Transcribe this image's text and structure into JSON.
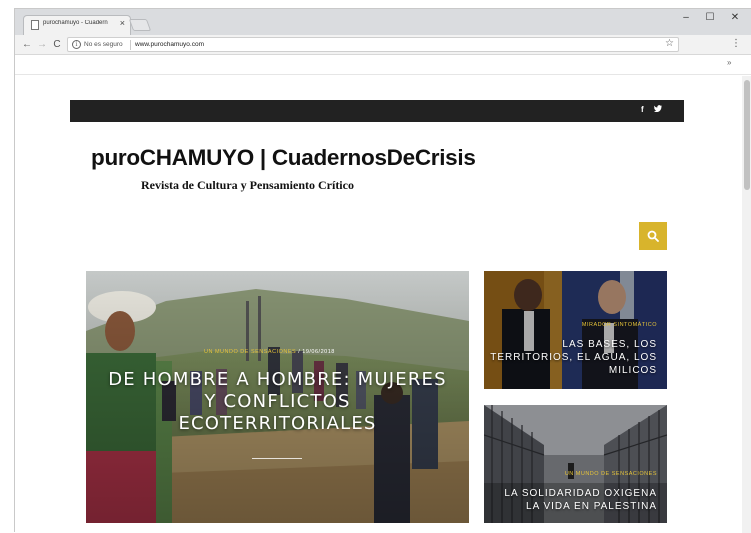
{
  "browser": {
    "tab_title": "purochamuyo - Cuadern",
    "tab_close": "×",
    "security_label": "No es seguro",
    "url": "www.purochamuyo.com",
    "info_glyph": "i",
    "back": "←",
    "forward": "→",
    "reload": "C",
    "bookmark": "☆",
    "menu": "⋮",
    "extensions_chevron": "»",
    "minimize": "–",
    "maximize": "☐",
    "close": "✕"
  },
  "site": {
    "social_facebook": "f",
    "social_twitter": "𝕥",
    "title": "puroCHAMUYO | CuadernosDeCrisis",
    "tagline": "Revista de Cultura y Pensamiento Crítico",
    "search_icon": "search-icon"
  },
  "posts": {
    "hero": {
      "category": "UN MUNDO DE SENSACIONES",
      "date": "19/06/2018",
      "title_line1": "DE HOMBRE A HOMBRE: MUJERES",
      "title_line2": "Y CONFLICTOS",
      "title_line3": "ECOTERRITORIALES"
    },
    "card1": {
      "category": "MIRADOR SINTOMÁTICO",
      "title_line1": "LAS BASES, LOS",
      "title_line2": "TERRITORIOS, EL AGUA, LOS",
      "title_line3": "MILICOS"
    },
    "card2": {
      "category": "UN MUNDO DE SENSACIONES",
      "title_line1": "LA SOLIDARIDAD OXIGENA",
      "title_line2": "LA VIDA EN PALESTINA"
    }
  },
  "colors": {
    "accent": "#d8b42c",
    "topbar": "#222222"
  }
}
